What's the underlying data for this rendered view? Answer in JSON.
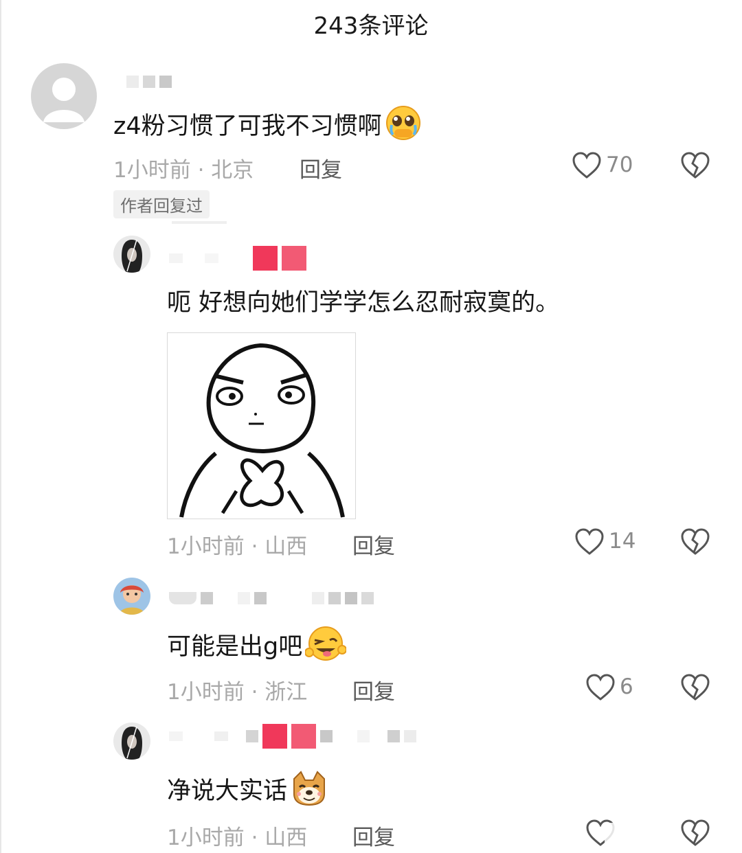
{
  "header": {
    "title": "243条评论"
  },
  "comments": [
    {
      "text": "z4粉习惯了可我不习惯啊",
      "time_location": "1小时前 · 北京",
      "reply_label": "回复",
      "likes": "70",
      "tag": "作者回复过",
      "emoji": "pleading-face-emoji"
    },
    {
      "text": "呃 好想向她们学学怎么忍耐寂寞的。",
      "time_location": "1小时前 · 山西",
      "reply_label": "回复",
      "likes": "14",
      "image": "meme-sticker"
    },
    {
      "text": "可能是出g吧",
      "time_location": "1小时前 · 浙江",
      "reply_label": "回复",
      "likes": "6",
      "emoji": "winking-tongue-emoji"
    },
    {
      "text": "净说大实话",
      "time_location": "1小时前 · 山西",
      "reply_label": "回复",
      "emoji": "doge-emoji"
    }
  ],
  "colors": {
    "meta": "#a8a8a8",
    "text": "#161616",
    "blur_pink": "#f0385a",
    "tag_bg": "#f1f1f1"
  }
}
